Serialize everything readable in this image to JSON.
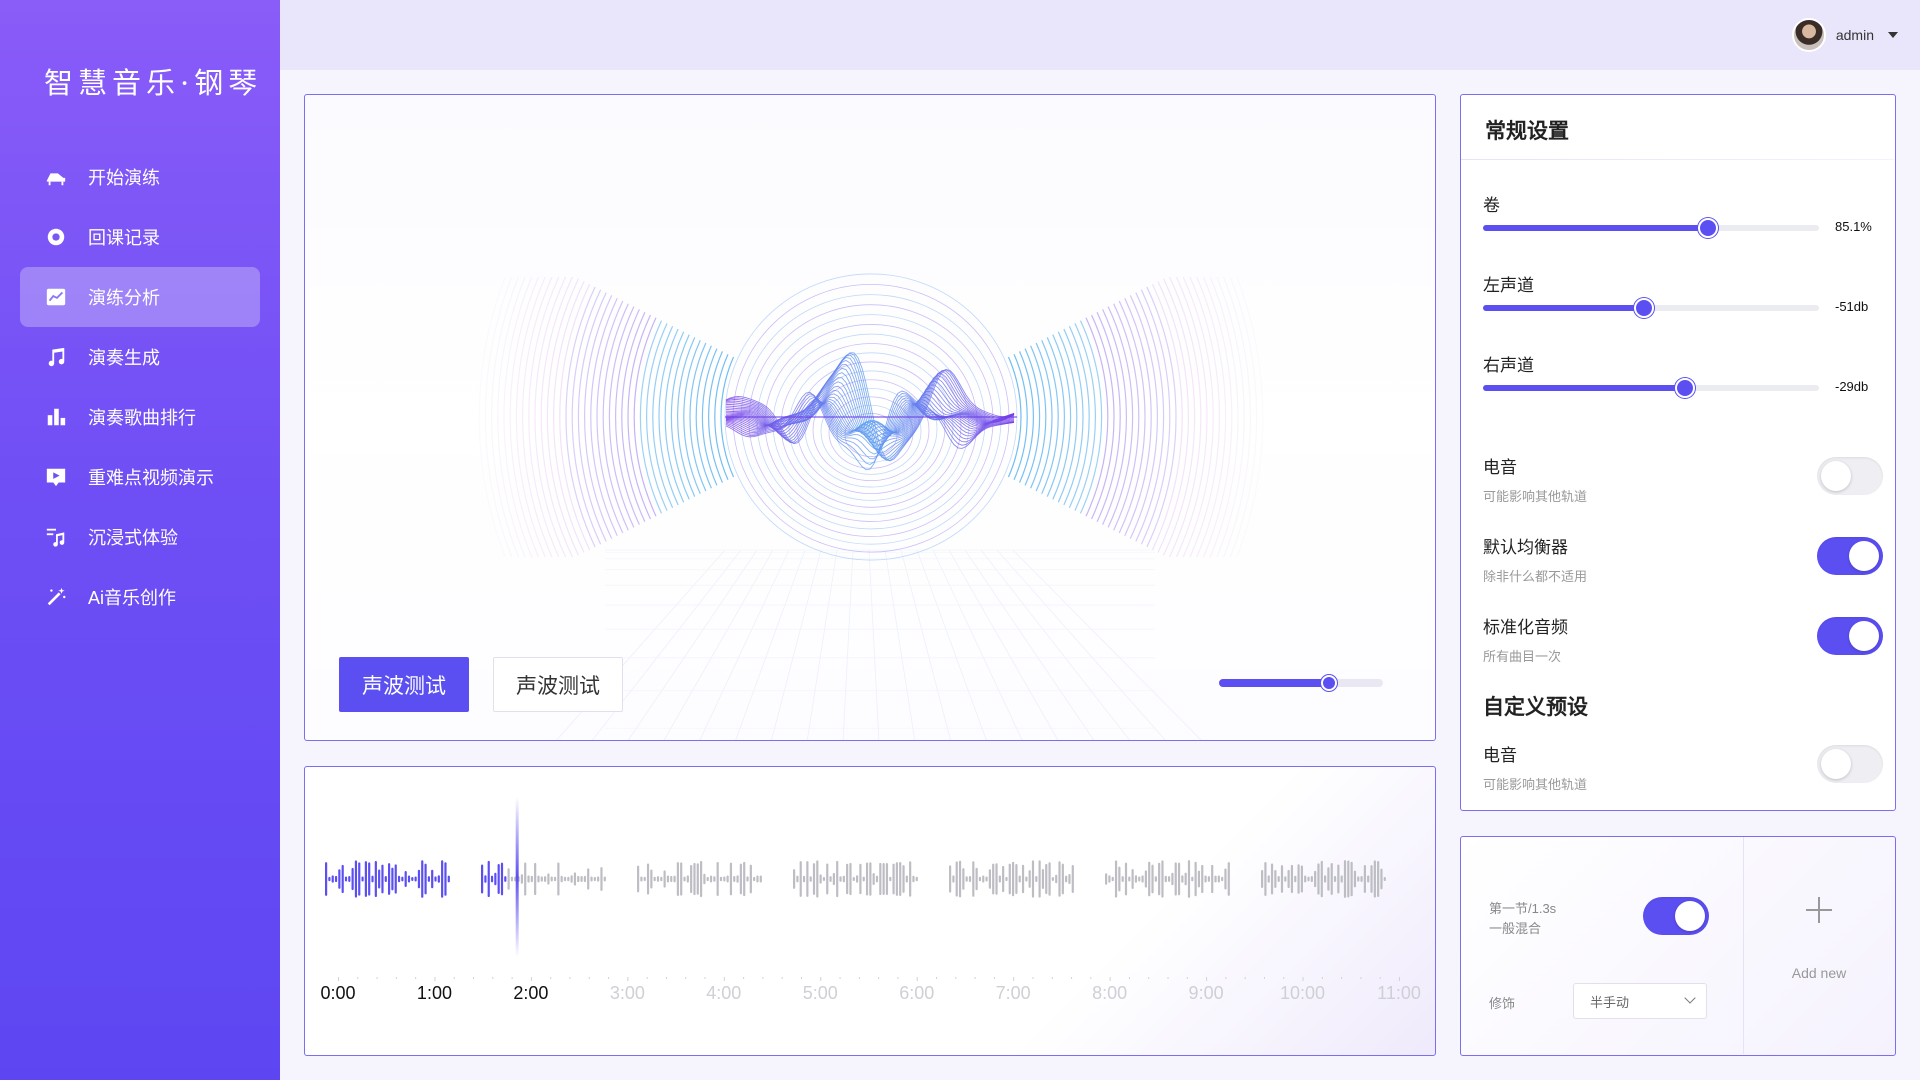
{
  "app": {
    "logo": "智慧音乐·钢琴"
  },
  "sidebar": {
    "items": [
      {
        "label": "开始演练",
        "icon": "piano-icon"
      },
      {
        "label": "回课记录",
        "icon": "record-icon"
      },
      {
        "label": "演练分析",
        "icon": "chart-line-icon",
        "active": true
      },
      {
        "label": "演奏生成",
        "icon": "music-note-icon"
      },
      {
        "label": "演奏歌曲排行",
        "icon": "bar-chart-icon"
      },
      {
        "label": "重难点视频演示",
        "icon": "video-play-icon"
      },
      {
        "label": "沉浸式体验",
        "icon": "music-list-icon"
      },
      {
        "label": "Ai音乐创作",
        "icon": "magic-wand-icon"
      }
    ]
  },
  "header": {
    "user": "admin"
  },
  "visualizer": {
    "primary_button": "声波测试",
    "secondary_button": "声波测试",
    "slider_value": 0.67
  },
  "waveform": {
    "played_fraction": 0.165,
    "time_labels": [
      "0:00",
      "1:00",
      "2:00",
      "3:00",
      "4:00",
      "5:00",
      "6:00",
      "7:00",
      "8:00",
      "9:00",
      "10:00",
      "11:00"
    ],
    "played_labels": 3
  },
  "settings": {
    "title": "常规设置",
    "sliders": [
      {
        "label": "卷",
        "value": "85.1%",
        "fraction": 0.67
      },
      {
        "label": "左声道",
        "value": "-51db",
        "fraction": 0.48
      },
      {
        "label": "右声道",
        "value": "-29db",
        "fraction": 0.6
      }
    ],
    "toggles": [
      {
        "title": "电音",
        "sub": "可能影响其他轨道",
        "on": false
      },
      {
        "title": "默认均衡器",
        "sub": "除非什么都不适用",
        "on": true
      },
      {
        "title": "标准化音频",
        "sub": "所有曲目一次",
        "on": true
      }
    ],
    "custom_title": "自定义预设",
    "custom_toggles": [
      {
        "title": "电音",
        "sub": "可能影响其他轨道",
        "on": false
      }
    ]
  },
  "mix": {
    "line1": "第一节/1.3s",
    "line2": "一般混合",
    "toggle_on": true,
    "decor_label": "修饰",
    "decor_value": "半手动",
    "add_label": "Add new"
  },
  "colors": {
    "accent": "#5b4ff2",
    "sidebar_top": "#8a5cf8",
    "sidebar_bottom": "#5d46f2"
  }
}
